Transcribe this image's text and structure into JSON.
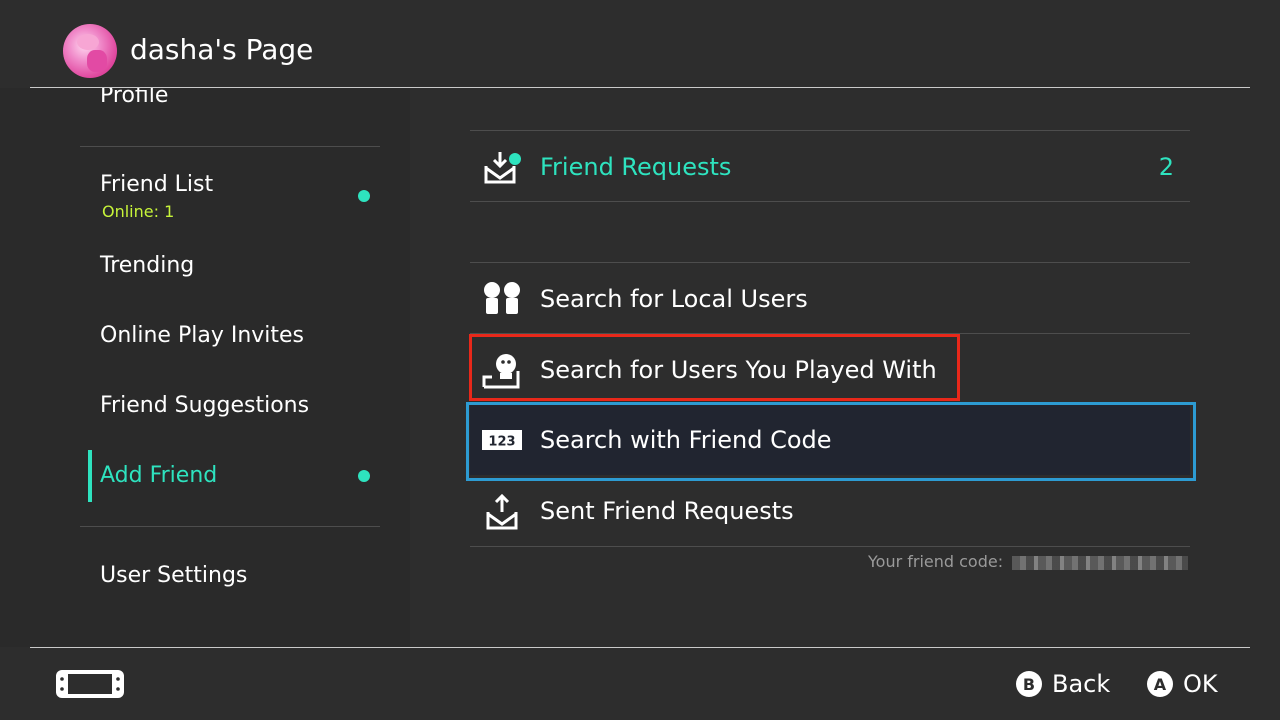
{
  "header": {
    "title": "dasha's Page"
  },
  "sidebar": {
    "items": [
      {
        "label": "Profile"
      },
      {
        "label": "Friend List",
        "sub": "Online: 1"
      },
      {
        "label": "Trending"
      },
      {
        "label": "Online Play Invites"
      },
      {
        "label": "Friend Suggestions"
      },
      {
        "label": "Add Friend"
      },
      {
        "label": "User Settings"
      }
    ],
    "active": "Add Friend"
  },
  "content": {
    "friend_requests": {
      "label": "Friend Requests",
      "count": "2"
    },
    "rows": [
      {
        "label": "Search for Local Users",
        "icon": "local-users-icon"
      },
      {
        "label": "Search for Users You Played With",
        "icon": "played-with-icon"
      },
      {
        "label": "Search with Friend Code",
        "icon": "friend-code-icon"
      },
      {
        "label": "Sent Friend Requests",
        "icon": "sent-requests-icon"
      }
    ],
    "friend_code_label": "Your friend code:"
  },
  "footer": {
    "back": {
      "button": "B",
      "label": "Back"
    },
    "ok": {
      "button": "A",
      "label": "OK"
    }
  },
  "colors": {
    "accent": "#2ee3bf",
    "selection": "#2d9bd2",
    "highlight": "#e8281a",
    "online": "#c7f43a"
  }
}
